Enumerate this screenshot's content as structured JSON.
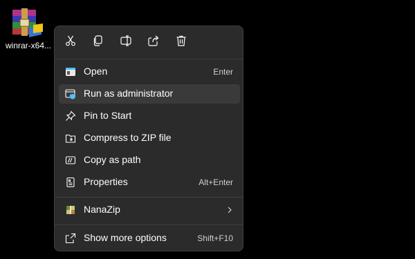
{
  "desktop": {
    "icon_label": "winrar-x64...",
    "icon_name": "winrar-archive-icon"
  },
  "toolbar": [
    {
      "name": "cut",
      "icon": "scissors-icon"
    },
    {
      "name": "copy",
      "icon": "copy-icon"
    },
    {
      "name": "rename",
      "icon": "rename-icon"
    },
    {
      "name": "share",
      "icon": "share-icon"
    },
    {
      "name": "delete",
      "icon": "trash-icon"
    }
  ],
  "menu": {
    "items": [
      {
        "label": "Open",
        "accelerator": "Enter",
        "icon": "open-window-icon"
      },
      {
        "label": "Run as administrator",
        "accelerator": "",
        "icon": "shield-window-icon"
      },
      {
        "label": "Pin to Start",
        "accelerator": "",
        "icon": "pin-icon"
      },
      {
        "label": "Compress to ZIP file",
        "accelerator": "",
        "icon": "zip-folder-icon"
      },
      {
        "label": "Copy as path",
        "accelerator": "",
        "icon": "copy-path-icon"
      },
      {
        "label": "Properties",
        "accelerator": "Alt+Enter",
        "icon": "properties-icon"
      },
      {
        "label": "NanaZip",
        "accelerator": "",
        "icon": "nanazip-icon"
      },
      {
        "label": "Show more options",
        "accelerator": "Shift+F10",
        "icon": "show-more-icon"
      }
    ]
  },
  "colors": {
    "background": "#000000",
    "menu_bg": "#2b2b2b",
    "hover_bg": "#3a3a3a",
    "accent_blue": "#4cc2ff"
  }
}
